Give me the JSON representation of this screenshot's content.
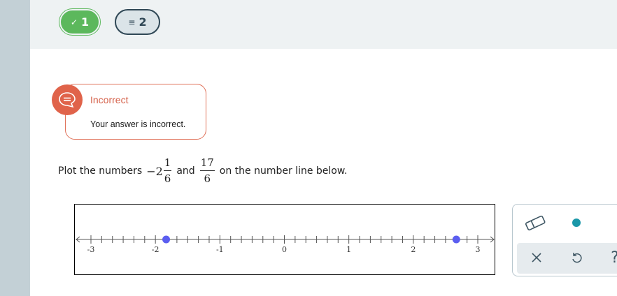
{
  "progress": {
    "correct_count": "1",
    "current_count": "2",
    "correct_icon": "check-icon",
    "current_icon": "list-icon"
  },
  "feedback": {
    "title": "Incorrect",
    "message": "Your answer is incorrect.",
    "icon": "speech-bubble-icon",
    "color": "#e0634a"
  },
  "question": {
    "prefix": "Plot the numbers",
    "n1_sign": "−",
    "n1_whole": "2",
    "n1_num": "1",
    "n1_den": "6",
    "joiner": "and",
    "n2_num": "17",
    "n2_den": "6",
    "suffix": "on the number line below."
  },
  "number_line": {
    "min": -3,
    "max": 3,
    "minor_step": 0.16666666666666666,
    "labels": [
      "-3",
      "-2",
      "-1",
      "0",
      "1",
      "2",
      "3"
    ],
    "plotted_points": [
      -1.8333333333333333,
      2.6666666666666665
    ],
    "point_color": "#5b5ef0"
  },
  "toolbox": {
    "tools": [
      "eraser-icon",
      "point-tool-icon",
      "clear-icon",
      "undo-icon",
      "help-icon"
    ],
    "help_label": "?",
    "point_color": "#1a97a8"
  }
}
